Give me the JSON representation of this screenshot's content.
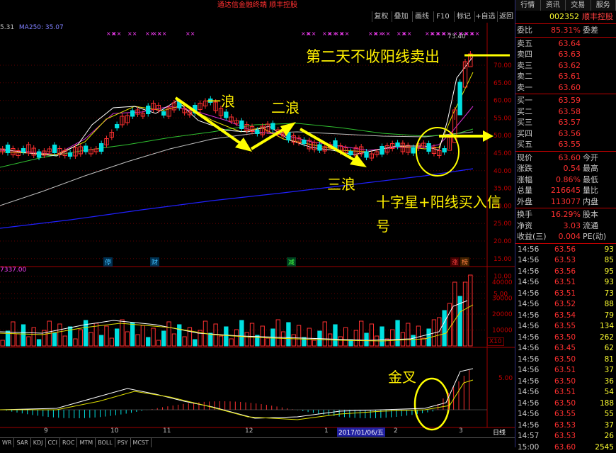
{
  "window": {
    "title": "通达信金融终端   顺丰控股"
  },
  "toolbar": {
    "buttons": [
      "复权",
      "叠加",
      "画线",
      "F10",
      "标记",
      "+自选",
      "返回"
    ]
  },
  "legend": {
    "ma250": "MA250: 35.07",
    "left_val": "5.31",
    "vol_label": "7337.00",
    "x10": "X10"
  },
  "annotations": {
    "sell": "第二天不收阳线卖出",
    "wave1": "一浪",
    "wave2": "二浪",
    "wave3": "三浪",
    "buy": "十字星+阳线买入信号",
    "cross": "金叉",
    "high": "73.40"
  },
  "price_axis": [
    "70.00",
    "65.00",
    "60.00",
    "55.00",
    "50.00",
    "45.00",
    "40.00",
    "35.00",
    "30.00",
    "25.00",
    "20.00",
    "15.00",
    "10.00",
    "5.00"
  ],
  "vol_axis": [
    "40000",
    "30000",
    "20000",
    "10000"
  ],
  "macd_axis": [
    "5.00"
  ],
  "date_axis": [
    {
      "label": "9"
    },
    {
      "label": "10"
    },
    {
      "label": "11"
    },
    {
      "label": "12"
    },
    {
      "label": "1"
    },
    {
      "label": "2017/01/06/五"
    },
    {
      "label": "2"
    },
    {
      "label": "3"
    }
  ],
  "markers": [
    "停",
    "财",
    "减",
    "涨",
    "榜"
  ],
  "period": "日线",
  "indicator_tabs": [
    "WR",
    "SAR",
    "KDJ",
    "CCI",
    "ROC",
    "MTM",
    "BOLL",
    "PSY",
    "MCST"
  ],
  "right_panel": {
    "tabs": [
      "行情",
      "资讯",
      "交易",
      "服务"
    ],
    "code": "002352",
    "name": "顺丰控股",
    "weibi": {
      "label": "委比",
      "value": "85.31%",
      "label2": "委差"
    },
    "asks": [
      {
        "label": "卖五",
        "price": "63.64"
      },
      {
        "label": "卖四",
        "price": "63.63"
      },
      {
        "label": "卖三",
        "price": "63.62"
      },
      {
        "label": "卖二",
        "price": "63.61"
      },
      {
        "label": "卖一",
        "price": "63.60"
      }
    ],
    "bids": [
      {
        "label": "买一",
        "price": "63.59"
      },
      {
        "label": "买二",
        "price": "63.58"
      },
      {
        "label": "买三",
        "price": "63.57"
      },
      {
        "label": "买四",
        "price": "63.56"
      },
      {
        "label": "买五",
        "price": "63.55"
      }
    ],
    "stats": [
      {
        "l": "现价",
        "v": "63.60",
        "r": "今开"
      },
      {
        "l": "涨跌",
        "v": "0.54",
        "r": "最高"
      },
      {
        "l": "涨幅",
        "v": "0.86%",
        "r": "最低"
      },
      {
        "l": "总量",
        "v": "216645",
        "r": "量比"
      },
      {
        "l": "外盘",
        "v": "113077",
        "r": "内盘"
      }
    ],
    "stats2": [
      {
        "l": "换手",
        "v": "16.29%",
        "r": "股本"
      },
      {
        "l": "净资",
        "v": "3.03",
        "r": "流通"
      },
      {
        "l": "收益(三)",
        "v": "0.004",
        "r": "PE(动)"
      }
    ],
    "ticks": [
      {
        "t": "14:56",
        "p": "63.56",
        "v": "93"
      },
      {
        "t": "14:56",
        "p": "63.53",
        "v": "85"
      },
      {
        "t": "14:56",
        "p": "63.56",
        "v": "95"
      },
      {
        "t": "14:56",
        "p": "63.51",
        "v": "93"
      },
      {
        "t": "14:56",
        "p": "63.51",
        "v": "73"
      },
      {
        "t": "14:56",
        "p": "63.52",
        "v": "88"
      },
      {
        "t": "14:56",
        "p": "63.54",
        "v": "79"
      },
      {
        "t": "14:56",
        "p": "63.55",
        "v": "134"
      },
      {
        "t": "14:56",
        "p": "63.50",
        "v": "262"
      },
      {
        "t": "14:56",
        "p": "63.45",
        "v": "62"
      },
      {
        "t": "14:56",
        "p": "63.50",
        "v": "81"
      },
      {
        "t": "14:56",
        "p": "63.51",
        "v": "37"
      },
      {
        "t": "14:56",
        "p": "63.50",
        "v": "36"
      },
      {
        "t": "14:56",
        "p": "63.51",
        "v": "54"
      },
      {
        "t": "14:56",
        "p": "63.50",
        "v": "188"
      },
      {
        "t": "14:56",
        "p": "63.55",
        "v": "55"
      },
      {
        "t": "14:56",
        "p": "63.53",
        "v": "37"
      },
      {
        "t": "14:57",
        "p": "63.53",
        "v": "26"
      },
      {
        "t": "15:00",
        "p": "63.60",
        "v": "2545"
      }
    ]
  }
}
